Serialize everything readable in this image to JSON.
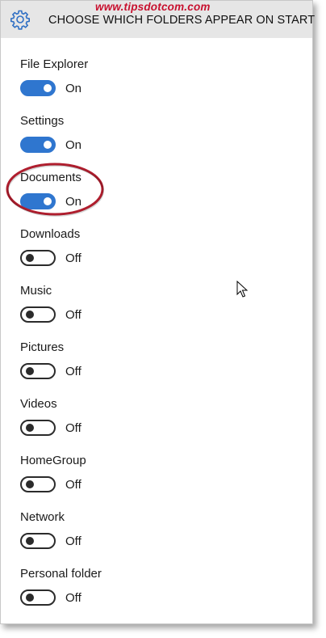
{
  "watermark": "www.tipsdotcom.com",
  "header": {
    "title": "CHOOSE WHICH FOLDERS APPEAR ON START",
    "icon": "gear-icon"
  },
  "colors": {
    "accent": "#2f76cf",
    "header_bg": "#e6e6e6",
    "annotation": "#b01e2e"
  },
  "folders": [
    {
      "label": "File Explorer",
      "state": "On",
      "on": true
    },
    {
      "label": "Settings",
      "state": "On",
      "on": true
    },
    {
      "label": "Documents",
      "state": "On",
      "on": true
    },
    {
      "label": "Downloads",
      "state": "Off",
      "on": false
    },
    {
      "label": "Music",
      "state": "Off",
      "on": false
    },
    {
      "label": "Pictures",
      "state": "Off",
      "on": false
    },
    {
      "label": "Videos",
      "state": "Off",
      "on": false
    },
    {
      "label": "HomeGroup",
      "state": "Off",
      "on": false
    },
    {
      "label": "Network",
      "state": "Off",
      "on": false
    },
    {
      "label": "Personal folder",
      "state": "Off",
      "on": false
    }
  ]
}
